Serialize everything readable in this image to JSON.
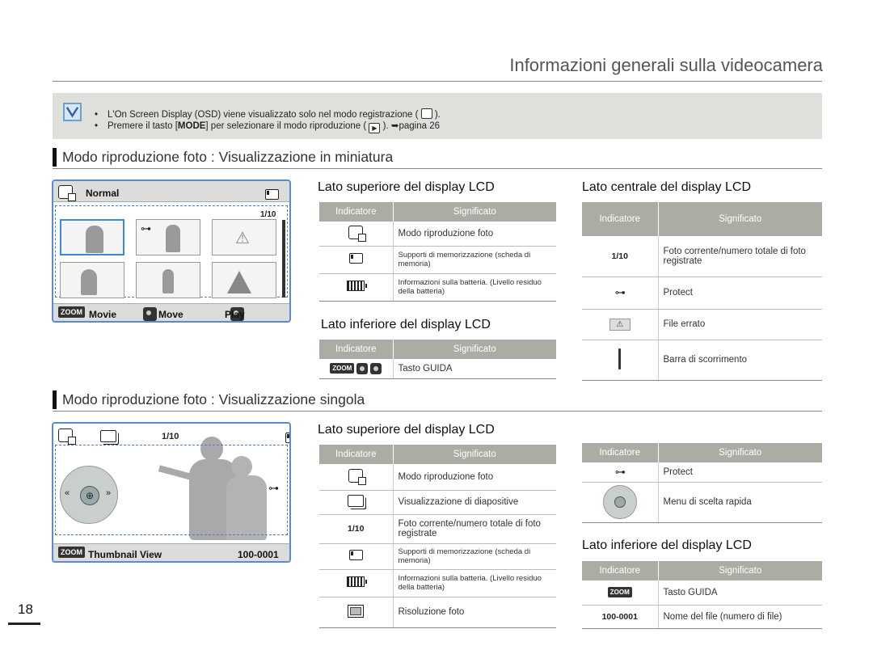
{
  "header": {
    "title": "Informazioni generali sulla videocamera"
  },
  "note": {
    "line1_a": "L'On Screen Display (OSD) viene visualizzato solo nel modo registrazione (",
    "line1_b": ").",
    "line2_a": "Premere il tasto [",
    "line2_bold": "MODE",
    "line2_b": "] per selezionare il modo riproduzione (",
    "line2_c": "). ➥pagina 26"
  },
  "section1": {
    "title": "Modo riproduzione foto : Visualizzazione in miniatura",
    "lcd": {
      "mode": "Normal",
      "counter": "1/10",
      "zoom": "ZOOM",
      "movie": "Movie",
      "move": "Move",
      "play": "Play"
    },
    "top_table": {
      "heading": "Lato superiore del display LCD",
      "col1": "Indicatore",
      "col2": "Significato",
      "rows": [
        {
          "sig": "Modo riproduzione foto"
        },
        {
          "sig": "Supporti di memorizzazione (scheda di memoria)"
        },
        {
          "sig": "Informazioni sulla batteria. (Livello residuo della batteria)"
        }
      ]
    },
    "bottom_table": {
      "heading": "Lato inferiore del display LCD",
      "col1": "Indicatore",
      "col2": "Significato",
      "zoom": "ZOOM",
      "rows": [
        {
          "sig": "Tasto GUIDA"
        }
      ]
    },
    "center_table": {
      "heading": "Lato centrale del display LCD",
      "col1": "Indicatore",
      "col2": "Significato",
      "rows": [
        {
          "ind": "1/10",
          "sig": "Foto corrente/numero totale di foto registrate"
        },
        {
          "sig": "Protect"
        },
        {
          "sig": "File errato"
        },
        {
          "sig": "Barra di scorrimento"
        }
      ]
    }
  },
  "section2": {
    "title": "Modo riproduzione foto : Visualizzazione singola",
    "lcd": {
      "counter": "1/10",
      "zoom": "ZOOM",
      "thumb": "Thumbnail View",
      "file": "100-0001"
    },
    "top_table": {
      "heading": "Lato superiore del display LCD",
      "col1": "Indicatore",
      "col2": "Significato",
      "rows": [
        {
          "sig": "Modo riproduzione foto"
        },
        {
          "sig": "Visualizzazione di diapositive"
        },
        {
          "ind": "1/10",
          "sig": "Foto corrente/numero totale di foto registrate"
        },
        {
          "sig": "Supporti di memorizzazione (scheda di memoria)"
        },
        {
          "sig": "Informazioni sulla batteria. (Livello residuo della batteria)"
        },
        {
          "sig": "Risoluzione foto"
        }
      ]
    },
    "right_table": {
      "col1": "Indicatore",
      "col2": "Significato",
      "rows": [
        {
          "sig": "Protect"
        },
        {
          "sig": "Menu di scelta rapida"
        }
      ]
    },
    "bottom_table": {
      "heading": "Lato inferiore del display LCD",
      "col1": "Indicatore",
      "col2": "Significato",
      "rows": [
        {
          "ind": "ZOOM",
          "sig": "Tasto GUIDA"
        },
        {
          "ind": "100-0001",
          "sig": "Nome del file (numero di file)"
        }
      ]
    }
  },
  "page_number": "18"
}
